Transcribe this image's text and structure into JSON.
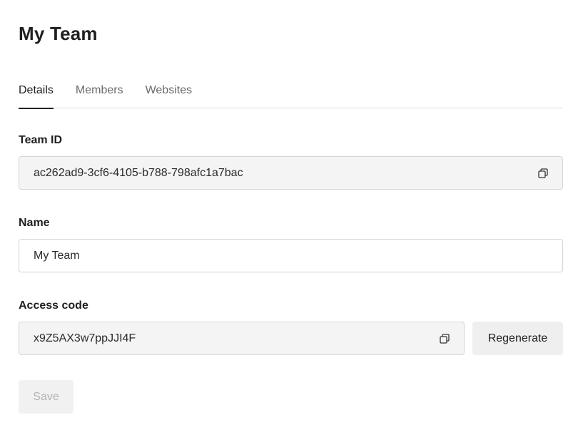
{
  "page": {
    "title": "My Team"
  },
  "tabs": [
    {
      "label": "Details",
      "active": true
    },
    {
      "label": "Members",
      "active": false
    },
    {
      "label": "Websites",
      "active": false
    }
  ],
  "team_id": {
    "label": "Team ID",
    "value": "ac262ad9-3cf6-4105-b788-798afc1a7bac",
    "icon": "copy-icon"
  },
  "name": {
    "label": "Name",
    "value": "My Team"
  },
  "access_code": {
    "label": "Access code",
    "value": "x9Z5AX3w7ppJJI4F",
    "icon": "copy-icon",
    "regenerate_label": "Regenerate"
  },
  "actions": {
    "save_label": "Save",
    "save_disabled": true
  }
}
